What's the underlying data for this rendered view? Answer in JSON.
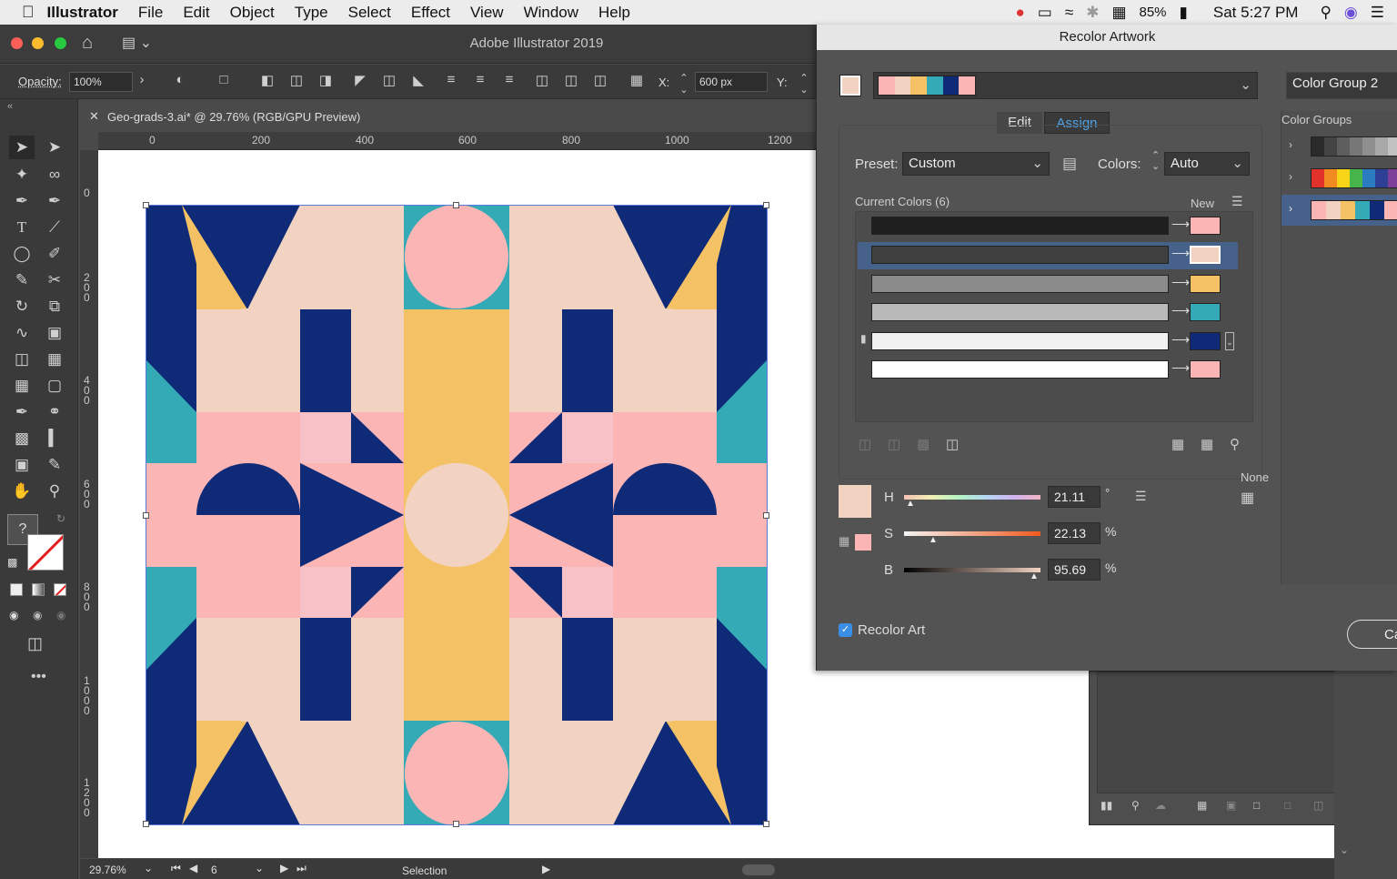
{
  "menubar": {
    "app": "Illustrator",
    "items": [
      "File",
      "Edit",
      "Object",
      "Type",
      "Select",
      "Effect",
      "View",
      "Window",
      "Help"
    ],
    "battery": "85%",
    "clock": "Sat 5:27 PM"
  },
  "window": {
    "title": "Adobe Illustrator 2019"
  },
  "control": {
    "opacity_label": "Opacity:",
    "opacity_value": "100%",
    "x_label": "X:",
    "x_value": "600 px",
    "y_label": "Y:"
  },
  "document": {
    "tab": "Geo-grads-3.ai* @ 29.76% (RGB/GPU Preview)"
  },
  "rulers": {
    "h": [
      "0",
      "200",
      "400",
      "600",
      "800",
      "1000",
      "1200"
    ],
    "v": [
      "0",
      "200",
      "400",
      "600",
      "800",
      "1000",
      "1200"
    ]
  },
  "status": {
    "zoom": "29.76%",
    "artboard": "6",
    "tool": "Selection"
  },
  "artwork": {
    "colors": {
      "navy": "#0f2b78",
      "pink": "#fbb5b5",
      "peach": "#f2d3c2",
      "yellow": "#f4c264",
      "teal": "#35aab7",
      "lightpink": "#f7c1c7"
    }
  },
  "dialog": {
    "title": "Recolor Artwork",
    "group_name": "Color Group 2",
    "tabs": {
      "edit": "Edit",
      "assign": "Assign"
    },
    "preset_label": "Preset:",
    "preset_value": "Custom",
    "colors_label": "Colors:",
    "colors_value": "Auto",
    "current_colors": "Current Colors (6)",
    "new_label": "New",
    "rows": [
      {
        "current": "#1f1f1f",
        "new": "#fbb5b5"
      },
      {
        "current": "#3f3f3f",
        "new": "#f2d3c2"
      },
      {
        "current": "#8a8a8a",
        "new": "#f4c264"
      },
      {
        "current": "#b9b9b9",
        "new": "#35aab7"
      },
      {
        "current": "#f1f1f1",
        "new": "#0f2b78"
      },
      {
        "current": "#ffffff",
        "new": "#fbb5b5"
      }
    ],
    "none_label": "None",
    "h_label": "H",
    "h_value": "21.11",
    "h_unit": "°",
    "s_label": "S",
    "s_value": "22.13",
    "s_unit": "%",
    "b_label": "B",
    "b_value": "95.69",
    "b_unit": "%",
    "recolor_art": "Recolor Art",
    "cancel_partial": "Car",
    "groups_title": "Color Groups",
    "groups": [
      [
        "#2a2a2a",
        "#444",
        "#5e5e5e",
        "#777",
        "#8f8f8f",
        "#a8a8a8",
        "#c2c2c2"
      ],
      [
        "#e2312b",
        "#f28b21",
        "#f7d417",
        "#46b549",
        "#2a7cc1",
        "#2f3f96",
        "#7e3f98"
      ],
      [
        "#fbb5b5",
        "#f2d3c2",
        "#f4c264",
        "#35aab7",
        "#0f2b78",
        "#fbb5b5"
      ]
    ]
  }
}
